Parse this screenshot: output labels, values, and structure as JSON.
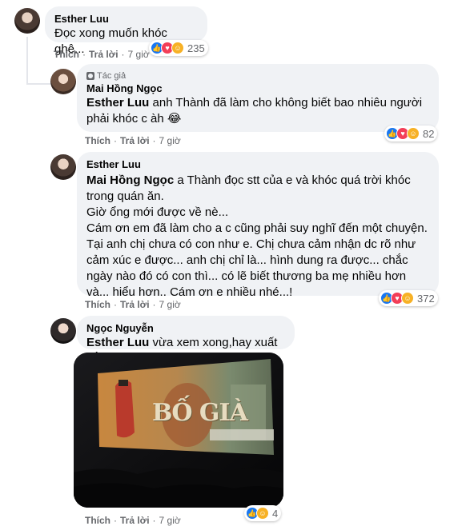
{
  "comments": [
    {
      "author": "Esther Luu",
      "text": "Đọc xong muốn khóc ghê...",
      "like_label": "Thích",
      "reply_label": "Trả lời",
      "time": "7 giờ",
      "reaction_count": "235",
      "replies": [
        {
          "badge": "Tác giả",
          "author": "Mai Hồng Ngọc",
          "mention": "Esther Luu",
          "text": " anh Thành đã làm cho không biết bao nhiêu người phải khóc c àh 😂",
          "like_label": "Thích",
          "reply_label": "Trả lời",
          "time": "7 giờ",
          "reaction_count": "82"
        },
        {
          "author": "Esther Luu",
          "mention": "Mai Hồng Ngọc",
          "text_line1": " a Thành đọc stt của e và khóc quá trời khóc trong quán ăn.",
          "text_line2": "Giờ ổng mới được về nè...",
          "text_line3": "Cám ơn em đã làm cho a c cũng phải suy nghĩ đến một chuyện. Tại anh chị chưa có con như e. Chị chưa cảm nhận dc rõ như cảm xúc e được... anh chị chỉ là... hình dung ra được... chắc ngày nào đó có con thì... có lẽ biết thương ba mẹ nhiều hơn và... hiểu hơn.. Cám ơn e nhiều nhé...!",
          "like_label": "Thích",
          "reply_label": "Trả lời",
          "time": "7 giờ",
          "reaction_count": "372"
        },
        {
          "author": "Ngọc Nguyễn",
          "mention": "Esther Luu",
          "text": " vừa xem xong,hay xuất sắc",
          "photo_title": "BỐ GIÀ",
          "like_label": "Thích",
          "reply_label": "Trả lời",
          "time": "7 giờ",
          "reaction_count": "4"
        }
      ]
    }
  ],
  "icons": {
    "like": "like-icon",
    "love": "love-icon",
    "care": "care-icon",
    "haha": "haha-icon",
    "author_badge": "author-badge-icon"
  },
  "colors": {
    "bubble": "#f0f2f5",
    "like": "#1877f2",
    "love": "#f33e58",
    "care": "#f7b125",
    "meta": "#65676b"
  }
}
